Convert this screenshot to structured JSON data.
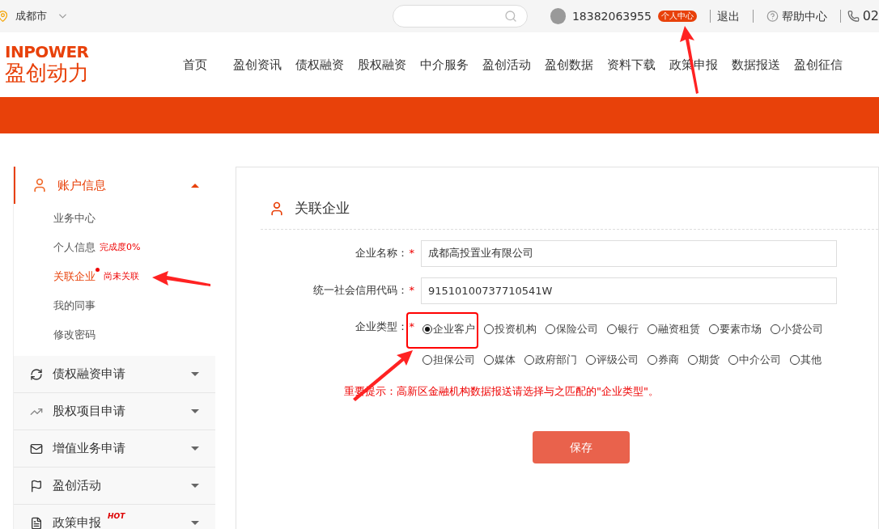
{
  "topbar": {
    "city": "成都市",
    "phone": "18382063955",
    "badge": "个人中心",
    "logout": "退出",
    "help": "帮助中心",
    "hotline": "02"
  },
  "logo": {
    "latin": "INPOWER",
    "chinese": "盈创动力"
  },
  "nav": [
    {
      "label": "首页"
    },
    {
      "label": "盈创资讯"
    },
    {
      "label": "债权融资"
    },
    {
      "label": "股权融资"
    },
    {
      "label": "中介服务"
    },
    {
      "label": "盈创活动"
    },
    {
      "label": "盈创数据"
    },
    {
      "label": "资料下载"
    },
    {
      "label": "政策申报"
    },
    {
      "label": "数据报送"
    },
    {
      "label": "盈创征信"
    }
  ],
  "sidebar": {
    "sections": [
      {
        "kind": "account",
        "label": "账户信息",
        "expanded": true,
        "children": [
          {
            "label": "业务中心",
            "selected": false,
            "dot": false
          },
          {
            "label": "个人信息",
            "selected": false,
            "dot": false,
            "note": "完成度0%"
          },
          {
            "label": "关联企业",
            "selected": true,
            "dot": true,
            "note": "尚未关联"
          },
          {
            "label": "我的同事",
            "selected": false,
            "dot": false
          },
          {
            "label": "修改密码",
            "selected": false,
            "dot": false
          }
        ]
      },
      {
        "kind": "debt",
        "label": "债权融资申请",
        "expanded": false
      },
      {
        "kind": "equity",
        "label": "股权项目申请",
        "expanded": false
      },
      {
        "kind": "service",
        "label": "增值业务申请",
        "expanded": false
      },
      {
        "kind": "event",
        "label": "盈创活动",
        "expanded": false
      },
      {
        "kind": "policy",
        "label": "政策申报",
        "expanded": false,
        "hot": "HOT"
      }
    ]
  },
  "panel": {
    "title": "关联企业",
    "fields": [
      {
        "label": "企业名称：",
        "required": "*",
        "value": "成都高投置业有限公司"
      },
      {
        "label": "统一社会信用代码：",
        "required": "*",
        "value": "91510100737710541W"
      }
    ],
    "type_field": {
      "label": "企业类型：",
      "required": "*",
      "options": [
        {
          "label": "企业客户",
          "selected": true
        },
        {
          "label": "投资机构",
          "selected": false
        },
        {
          "label": "保险公司",
          "selected": false
        },
        {
          "label": "银行",
          "selected": false
        },
        {
          "label": "融资租赁",
          "selected": false
        },
        {
          "label": "要素市场",
          "selected": false
        },
        {
          "label": "小贷公司",
          "selected": false
        },
        {
          "label": "担保公司",
          "selected": false
        },
        {
          "label": "媒体",
          "selected": false
        },
        {
          "label": "政府部门",
          "selected": false
        },
        {
          "label": "评级公司",
          "selected": false
        },
        {
          "label": "券商",
          "selected": false
        },
        {
          "label": "期货",
          "selected": false
        },
        {
          "label": "中介公司",
          "selected": false
        },
        {
          "label": "其他",
          "selected": false
        }
      ]
    },
    "notice": "重要提示：高新区金融机构数据报送请选择与之匹配的\"企业类型\"。",
    "save": "保存"
  }
}
